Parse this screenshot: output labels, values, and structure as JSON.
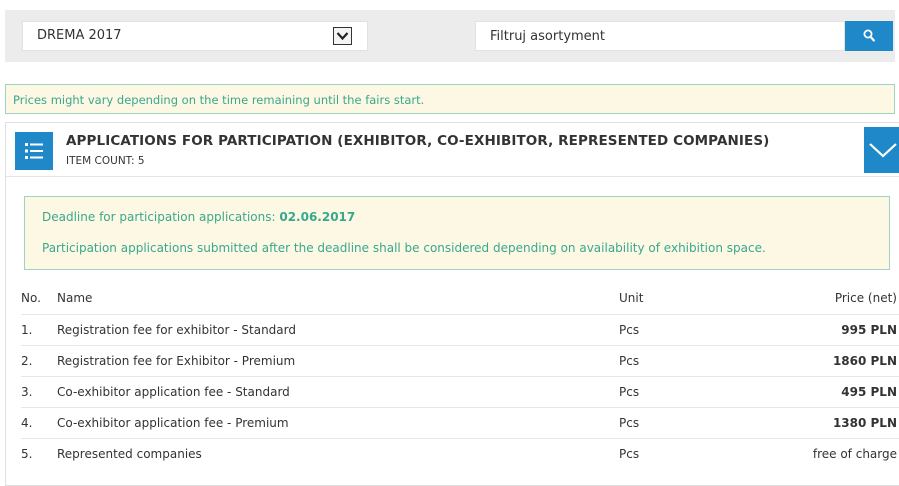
{
  "toolbar": {
    "event_select": {
      "value": "DREMA 2017"
    },
    "filter": {
      "placeholder": "Filtruj asortyment"
    }
  },
  "notice": "Prices might vary depending on the time remaining until the fairs start.",
  "section": {
    "title": "APPLICATIONS FOR PARTICIPATION (EXHIBITOR, CO-EXHIBITOR, REPRESENTED COMPANIES)",
    "item_count": "ITEM COUNT: 5",
    "deadline_label": "Deadline for participation applications:",
    "deadline_date": "02.06.2017",
    "deadline_note": "Participation applications submitted after the deadline shall be considered depending on availability of exhibition space."
  },
  "table": {
    "headers": {
      "no": "No.",
      "name": "Name",
      "unit": "Unit",
      "price": "Price (net)"
    },
    "rows": [
      {
        "no": "1.",
        "name": "Registration fee for exhibitor - Standard",
        "unit": "Pcs",
        "price": "995 PLN"
      },
      {
        "no": "2.",
        "name": "Registration fee for Exhibitor - Premium",
        "unit": "Pcs",
        "price": "1860 PLN"
      },
      {
        "no": "3.",
        "name": "Co-exhibitor application fee - Standard",
        "unit": "Pcs",
        "price": "495 PLN"
      },
      {
        "no": "4.",
        "name": "Co-exhibitor application fee - Premium",
        "unit": "Pcs",
        "price": "1380 PLN"
      },
      {
        "no": "5.",
        "name": "Represented companies",
        "unit": "Pcs",
        "price": "free of charge"
      }
    ]
  },
  "colors": {
    "accent": "#1f88c9",
    "notice_text": "#38a88d",
    "notice_bg": "#fdf8e4",
    "notice_border": "#9fd3c4"
  },
  "icons": {
    "dropdown": "chevron-down-icon",
    "search": "search-icon",
    "list": "list-icon",
    "collapse": "chevron-down-icon"
  }
}
